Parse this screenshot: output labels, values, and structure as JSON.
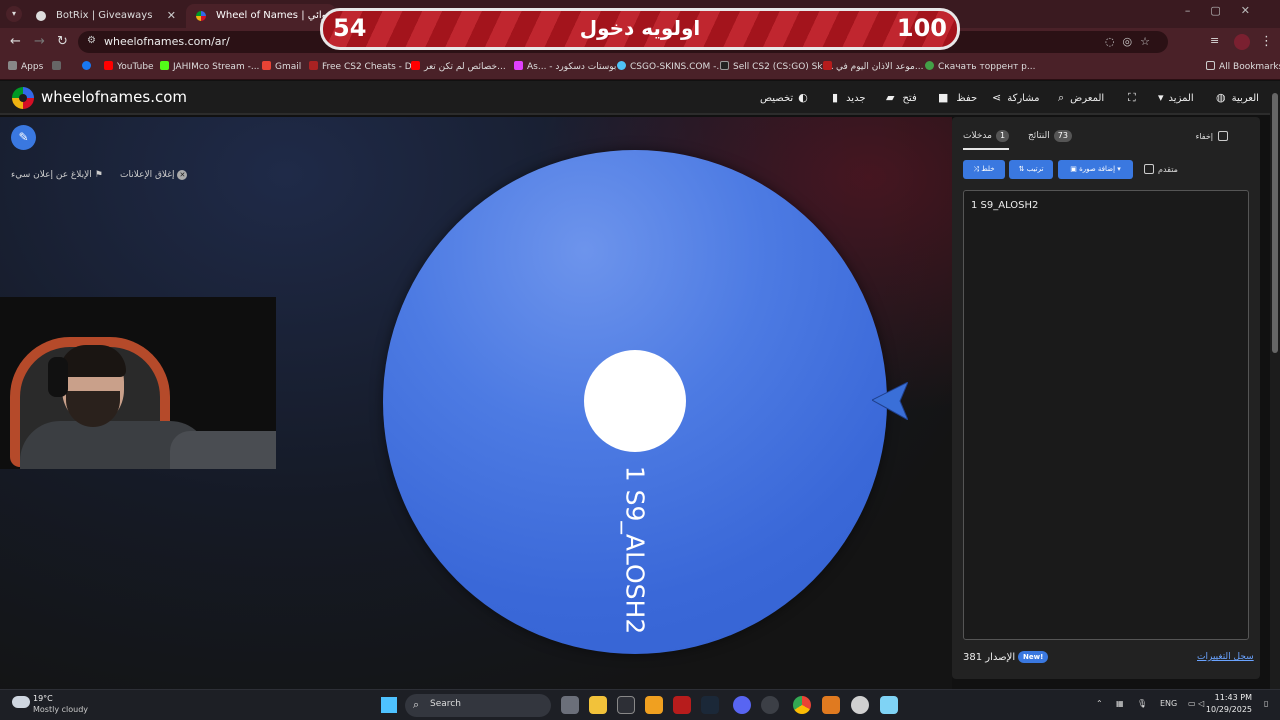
{
  "browser": {
    "tabs": [
      {
        "label": "BotRix | Giveaways"
      },
      {
        "label": "Wheel of Names | اسم العشوائي"
      }
    ],
    "url": "wheelofnames.com/ar/",
    "bookmarks_all": "All Bookmarks",
    "bookmarks": [
      {
        "label": "Apps",
        "color": "#888888"
      },
      {
        "label": "YouTube",
        "color": "#ff0000"
      },
      {
        "label": "JAHIMco Stream -...",
        "color": "#53fc18"
      },
      {
        "label": "Gmail",
        "color": "#ea4335"
      },
      {
        "label": "Free CS2 Cheats - D...",
        "color": "#aa2222"
      },
      {
        "label": "خصائص لم تكن تعر...",
        "color": "#ff0000"
      },
      {
        "label": "As... - بوستات دسكورد",
        "color": "#e040fb"
      },
      {
        "label": "CSGO-SKINS.COM -...",
        "color": "#4fc3f7"
      },
      {
        "label": "Sell CS2 (CS:GO) Ski...",
        "color": "#222222"
      },
      {
        "label": "موعد الاذان اليوم في...",
        "color": "#b71c1c"
      },
      {
        "label": "Скачать торрент р...",
        "color": "#43a047"
      }
    ]
  },
  "overlay": {
    "left_number": "54",
    "right_number": "100",
    "title": "اولويه دخول"
  },
  "site": {
    "brand": "wheelofnames.com",
    "menu": {
      "language": "العربية",
      "more": "المزيد",
      "gallery": "المعرض",
      "share": "مشاركة",
      "save": "حفظ",
      "open": "فتح",
      "new": "جديد",
      "customize": "تخصيص"
    },
    "ads": {
      "close_ads": "إغلاق الإعلانات",
      "report_ad": "الإبلاغ عن إعلان سيء"
    }
  },
  "wheel": {
    "segment_label": "1 S9_ALOSH2",
    "color": "#4d7be3"
  },
  "panel": {
    "tab_entries": "مدخلات",
    "tab_entries_count": "1",
    "tab_results": "النتائج",
    "tab_results_count": "73",
    "hide": "إخفاء",
    "advanced": "متقدم",
    "shuffle": "خلط",
    "sort": "ترتيب",
    "add_image": "إضافة صورة",
    "entries_text": "1 S9_ALOSH2",
    "version_label": "الإصدار",
    "version_number": "381",
    "new_badge": "New!",
    "changelog": "سجل التغييرات"
  },
  "taskbar": {
    "temp": "19°C",
    "condition": "Mostly cloudy",
    "search": "Search",
    "lang": "ENG",
    "time": "11:43 PM",
    "date": "10/29/2025"
  }
}
